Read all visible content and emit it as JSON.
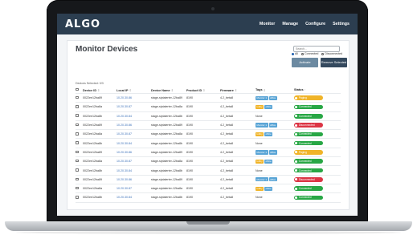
{
  "app": {
    "logo": "ALGO",
    "nav": [
      "Monitor",
      "Manage",
      "Configure",
      "Settings"
    ]
  },
  "page": {
    "title": "Monitor Devices",
    "search_placeholder": "Search...",
    "filters": [
      {
        "label": "All",
        "selected": true
      },
      {
        "label": "Connected",
        "selected": false
      },
      {
        "label": "Disconnected",
        "selected": false
      }
    ],
    "activate_label": "Activate",
    "remove_label": "Remove Selected",
    "selected_count": "Devices Selected: 0/3"
  },
  "table": {
    "headers": {
      "id": "Device ID",
      "ip": "Local IP",
      "name": "Device Name",
      "pid": "Product ID",
      "fw": "Firmware",
      "tags": "Tags",
      "status": "Status"
    },
    "sort_icon": "⇕",
    "status_sort_icon": "↑",
    "rows": [
      {
        "id": "0022ee12ba89",
        "ip": "10.20.30.86",
        "name": "stage-siptalerter-12ba89",
        "pid": "8190",
        "fw": "4.2_beta8",
        "tags": [
          {
            "t": "Monitor 1",
            "c": "blue"
          },
          {
            "t": "office",
            "c": "blue"
          }
        ],
        "status": "Paging",
        "color": "#f0b429"
      },
      {
        "id": "0022ee12ba8a",
        "ip": "10.20.30.87",
        "name": "stage-siptalerter-12ba8a",
        "pid": "8190",
        "fw": "4.2_beta8",
        "tags": [
          {
            "t": "lobby",
            "c": "gold"
          },
          {
            "t": "office",
            "c": "blue"
          }
        ],
        "status": "Connected",
        "color": "#28a745"
      },
      {
        "id": "0022ee12ba8b",
        "ip": "10.20.30.84",
        "name": "stage-siptalerter-12ba8b",
        "pid": "8190",
        "fw": "4.2_beta8",
        "tags": [
          {
            "t": "None",
            "c": "none"
          }
        ],
        "status": "Connected",
        "color": "#28a745"
      },
      {
        "id": "0022ee12ba89",
        "ip": "10.20.30.86",
        "name": "stage-siptalerter-12ba89",
        "pid": "8190",
        "fw": "4.2_beta8",
        "tags": [
          {
            "t": "Monitor 1",
            "c": "blue"
          },
          {
            "t": "office",
            "c": "blue"
          }
        ],
        "status": "Disconnected",
        "color": "#dc3545"
      },
      {
        "id": "0022ee12ba8a",
        "ip": "10.20.30.87",
        "name": "stage-siptalerter-12ba8a",
        "pid": "8190",
        "fw": "4.2_beta8",
        "tags": [
          {
            "t": "lobby",
            "c": "gold"
          },
          {
            "t": "office",
            "c": "blue"
          }
        ],
        "status": "Connected",
        "color": "#28a745"
      },
      {
        "id": "0022ee12ba8b",
        "ip": "10.20.30.84",
        "name": "stage-siptalerter-12ba8b",
        "pid": "8190",
        "fw": "4.2_beta8",
        "tags": [
          {
            "t": "None",
            "c": "none"
          }
        ],
        "status": "Connected",
        "color": "#28a745"
      },
      {
        "id": "0022ee12ba89",
        "ip": "10.20.30.86",
        "name": "stage-siptalerter-12ba89",
        "pid": "8190",
        "fw": "4.2_beta8",
        "tags": [
          {
            "t": "Monitor 1",
            "c": "blue"
          },
          {
            "t": "office",
            "c": "blue"
          }
        ],
        "status": "Paging",
        "color": "#f0b429"
      },
      {
        "id": "0022ee12ba8a",
        "ip": "10.20.30.87",
        "name": "stage-siptalerter-12ba8a",
        "pid": "8190",
        "fw": "4.2_beta8",
        "tags": [
          {
            "t": "lobby",
            "c": "gold"
          },
          {
            "t": "office",
            "c": "blue"
          }
        ],
        "status": "Connected",
        "color": "#28a745"
      },
      {
        "id": "0022ee12ba8b",
        "ip": "10.20.30.84",
        "name": "stage-siptalerter-12ba8b",
        "pid": "8190",
        "fw": "4.2_beta8",
        "tags": [
          {
            "t": "None",
            "c": "none"
          }
        ],
        "status": "Connected",
        "color": "#28a745"
      },
      {
        "id": "0022ee12ba89",
        "ip": "10.20.30.86",
        "name": "stage-siptalerter-12ba89",
        "pid": "8190",
        "fw": "4.2_beta8",
        "tags": [
          {
            "t": "Monitor 1",
            "c": "blue"
          },
          {
            "t": "office",
            "c": "blue"
          }
        ],
        "status": "Disconnected",
        "color": "#dc3545"
      },
      {
        "id": "0022ee12ba8a",
        "ip": "10.20.30.87",
        "name": "stage-siptalerter-12ba8a",
        "pid": "8190",
        "fw": "4.2_beta8",
        "tags": [
          {
            "t": "lobby",
            "c": "gold"
          },
          {
            "t": "office",
            "c": "blue"
          }
        ],
        "status": "Connected",
        "color": "#28a745"
      },
      {
        "id": "0022ee12ba8b",
        "ip": "10.20.30.84",
        "name": "stage-siptalerter-12ba8b",
        "pid": "8190",
        "fw": "4.2_beta8",
        "tags": [
          {
            "t": "None",
            "c": "none"
          }
        ],
        "status": "Connected",
        "color": "#28a745"
      }
    ]
  }
}
